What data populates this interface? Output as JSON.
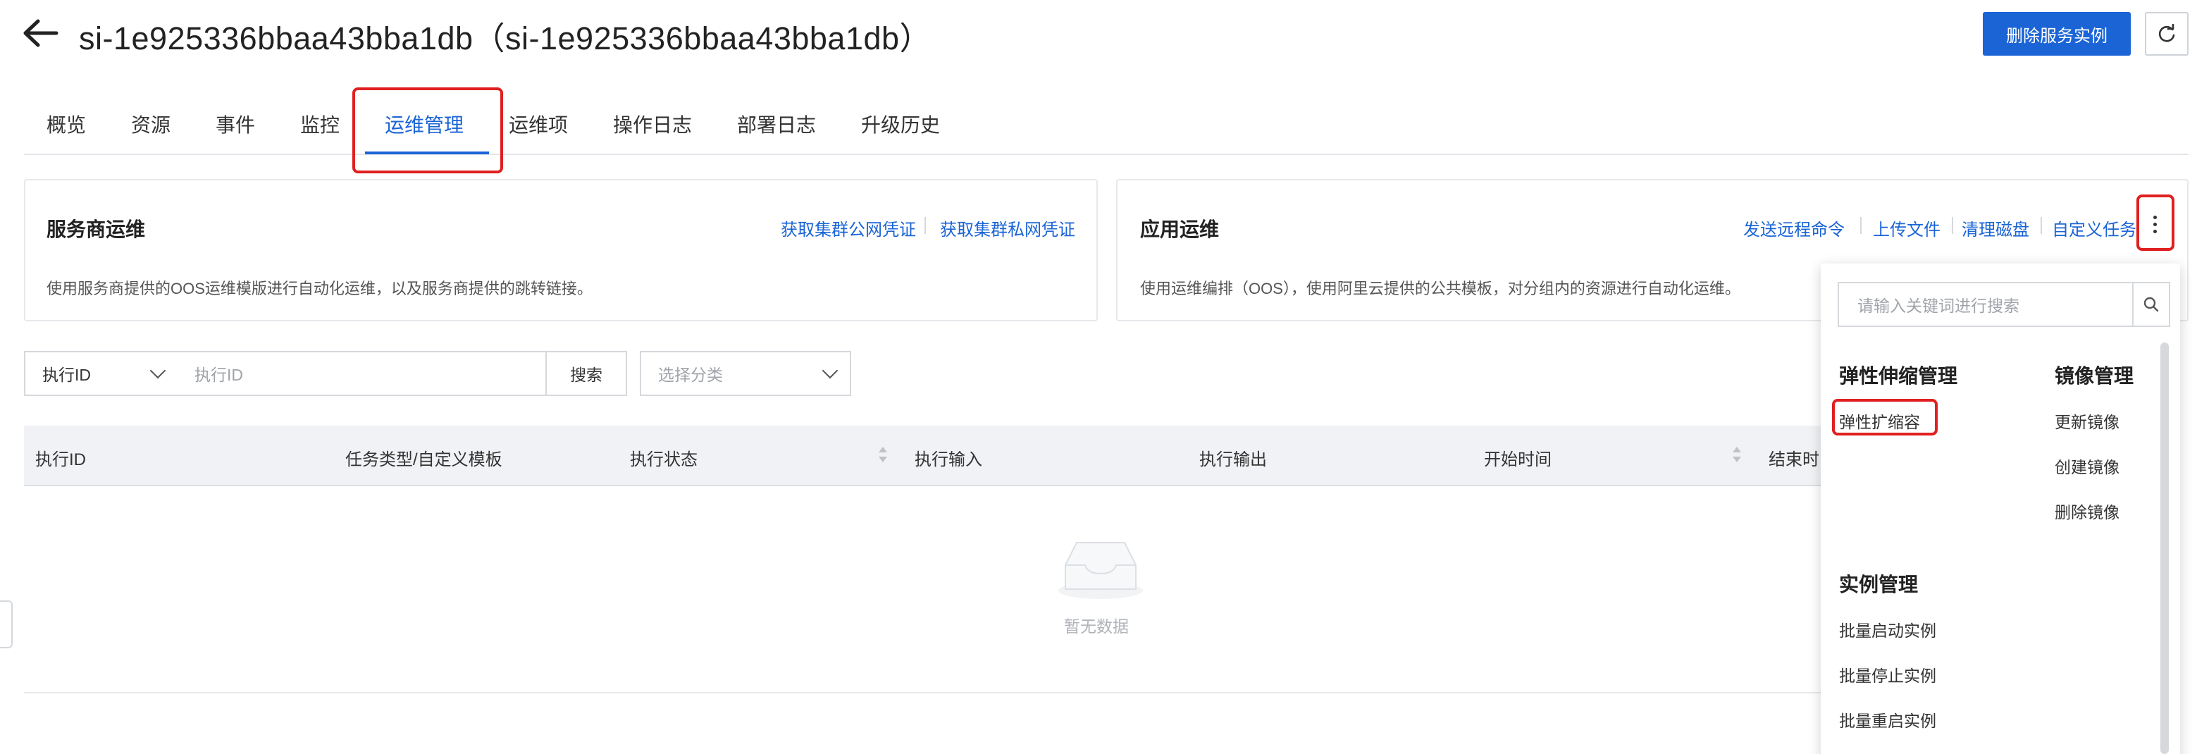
{
  "header": {
    "title": "si-1e925336bbaa43bba1db（si-1e925336bbaa43bba1db）",
    "delete_label": "删除服务实例"
  },
  "tabs": [
    {
      "label": "概览"
    },
    {
      "label": "资源"
    },
    {
      "label": "事件"
    },
    {
      "label": "监控"
    },
    {
      "label": "运维管理",
      "active": true
    },
    {
      "label": "运维项"
    },
    {
      "label": "操作日志"
    },
    {
      "label": "部署日志"
    },
    {
      "label": "升级历史"
    }
  ],
  "provider_ops": {
    "title": "服务商运维",
    "links": [
      "获取集群公网凭证",
      "获取集群私网凭证"
    ],
    "description": "使用服务商提供的OOS运维模版进行自动化运维，以及服务商提供的跳转链接。"
  },
  "app_ops": {
    "title": "应用运维",
    "links": [
      "发送远程命令",
      "上传文件",
      "清理磁盘",
      "自定义任务"
    ],
    "description": "使用运维编排（OOS），使用阿里云提供的公共模板，对分组内的资源进行自动化运维。"
  },
  "filter": {
    "field_select": "执行ID",
    "input_placeholder": "执行ID",
    "search_label": "搜索",
    "category_placeholder": "选择分类"
  },
  "table": {
    "columns": [
      "执行ID",
      "任务类型/自定义模板",
      "执行状态",
      "执行输入",
      "执行输出",
      "开始时间",
      "结束时"
    ],
    "empty_text": "暂无数据"
  },
  "dropdown": {
    "search_placeholder": "请输入关键词进行搜索",
    "groups": [
      {
        "title": "弹性伸缩管理",
        "items": [
          "弹性扩缩容"
        ]
      },
      {
        "title": "镜像管理",
        "items": [
          "更新镜像",
          "创建镜像",
          "删除镜像"
        ]
      },
      {
        "title": "实例管理",
        "items": [
          "批量启动实例",
          "批量停止实例",
          "批量重启实例"
        ]
      }
    ]
  },
  "colors": {
    "accent": "#1a64d6",
    "highlight": "#e02020"
  }
}
